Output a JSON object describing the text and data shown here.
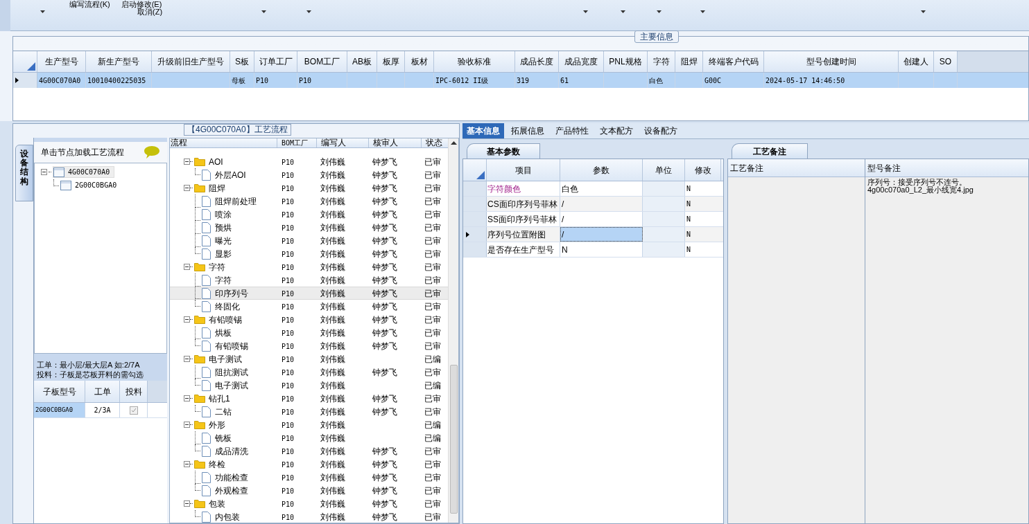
{
  "toolbar": {
    "buttons": [
      {
        "label": "编写流程(K)"
      },
      {
        "label": "启动修改(E)"
      },
      {
        "label": "取消(Z)"
      }
    ]
  },
  "main_info": {
    "title": "主要信息",
    "columns": [
      "生产型号",
      "新生产型号",
      "升级前旧生产型号",
      "S板",
      "订单工厂",
      "BOM工厂",
      "AB板",
      "板厚",
      "板材",
      "验收标准",
      "成品长度",
      "成品宽度",
      "PNL规格",
      "字符",
      "阻焊",
      "终端客户代码",
      "型号创建时间",
      "创建人",
      "SO"
    ],
    "rows": [
      {
        "selected": true,
        "cells": [
          "4G00C070A0",
          "10010400225035",
          null,
          "母板",
          "P10",
          "P10",
          null,
          null,
          null,
          "IPC-6012 II级",
          "319",
          "61",
          null,
          "白色",
          null,
          "G00C",
          "2024-05-17 14:46:50",
          null,
          null
        ]
      }
    ]
  },
  "structure_panel": {
    "tab": "设备结构",
    "hint": "单击节点加载工艺流程",
    "tree": [
      {
        "label": "4G00C070A0",
        "selected": true,
        "expanded": true,
        "children": [
          {
            "label": "2G00C0BGA0",
            "selected": false
          }
        ]
      }
    ],
    "notes": [
      "工单：最小层/最大层A 如:2/7A",
      "投料：子板是芯板开料的需勾选"
    ],
    "sub_table": {
      "columns": [
        "子板型号",
        "工单",
        "投料"
      ],
      "rows": [
        {
          "model": "2G00C0BGA0",
          "order": "2/3A",
          "feed": true
        }
      ]
    }
  },
  "process_flow": {
    "title": "【4G00C070A0】工艺流程",
    "columns": [
      "流程",
      "BOM工厂",
      "编写人",
      "核审人",
      "状态"
    ],
    "rows": [
      {
        "name": "AOI",
        "bom": "P10",
        "writer": "刘伟巍",
        "reviewer": "钟梦飞",
        "status": "已审",
        "expanded": true,
        "children": [
          {
            "name": "外层AOI",
            "bom": "P10",
            "writer": "刘伟巍",
            "reviewer": "钟梦飞",
            "status": "已审",
            "selected": false
          }
        ]
      },
      {
        "name": "阻焊",
        "bom": "P10",
        "writer": "刘伟巍",
        "reviewer": "钟梦飞",
        "status": "已审",
        "expanded": true,
        "children": [
          {
            "name": "阻焊前处理",
            "bom": "P10",
            "writer": "刘伟巍",
            "reviewer": "钟梦飞",
            "status": "已审",
            "selected": false
          },
          {
            "name": "喷涂",
            "bom": "P10",
            "writer": "刘伟巍",
            "reviewer": "钟梦飞",
            "status": "已审",
            "selected": false
          },
          {
            "name": "预烘",
            "bom": "P10",
            "writer": "刘伟巍",
            "reviewer": "钟梦飞",
            "status": "已审",
            "selected": false
          },
          {
            "name": "曝光",
            "bom": "P10",
            "writer": "刘伟巍",
            "reviewer": "钟梦飞",
            "status": "已审",
            "selected": false
          },
          {
            "name": "显影",
            "bom": "P10",
            "writer": "刘伟巍",
            "reviewer": "钟梦飞",
            "status": "已审",
            "selected": false
          }
        ]
      },
      {
        "name": "字符",
        "bom": "P10",
        "writer": "刘伟巍",
        "reviewer": "钟梦飞",
        "status": "已审",
        "expanded": true,
        "children": [
          {
            "name": "字符",
            "bom": "P10",
            "writer": "刘伟巍",
            "reviewer": "钟梦飞",
            "status": "已审",
            "selected": false
          },
          {
            "name": "印序列号",
            "bom": "P10",
            "writer": "刘伟巍",
            "reviewer": "钟梦飞",
            "status": "已审",
            "selected": true
          },
          {
            "name": "终固化",
            "bom": "P10",
            "writer": "刘伟巍",
            "reviewer": "钟梦飞",
            "status": "已审",
            "selected": false
          }
        ]
      },
      {
        "name": "有铅喷锡",
        "bom": "P10",
        "writer": "刘伟巍",
        "reviewer": "钟梦飞",
        "status": "已审",
        "expanded": true,
        "children": [
          {
            "name": "烘板",
            "bom": "P10",
            "writer": "刘伟巍",
            "reviewer": "钟梦飞",
            "status": "已审",
            "selected": false
          },
          {
            "name": "有铅喷锡",
            "bom": "P10",
            "writer": "刘伟巍",
            "reviewer": "钟梦飞",
            "status": "已审",
            "selected": false
          }
        ]
      },
      {
        "name": "电子测试",
        "bom": "P10",
        "writer": "刘伟巍",
        "status": "已编",
        "expanded": true,
        "children": [
          {
            "name": "阻抗测试",
            "bom": "P10",
            "writer": "刘伟巍",
            "reviewer": "钟梦飞",
            "status": "已审",
            "selected": false
          },
          {
            "name": "电子测试",
            "bom": "P10",
            "writer": "刘伟巍",
            "status": "已编",
            "selected": false
          }
        ]
      },
      {
        "name": "钻孔1",
        "bom": "P10",
        "writer": "刘伟巍",
        "reviewer": "钟梦飞",
        "status": "已审",
        "expanded": true,
        "children": [
          {
            "name": "二钻",
            "bom": "P10",
            "writer": "刘伟巍",
            "reviewer": "钟梦飞",
            "status": "已审",
            "selected": false
          }
        ]
      },
      {
        "name": "外形",
        "bom": "P10",
        "writer": "刘伟巍",
        "status": "已编",
        "expanded": true,
        "children": [
          {
            "name": "铣板",
            "bom": "P10",
            "writer": "刘伟巍",
            "status": "已编",
            "selected": false
          },
          {
            "name": "成品清洗",
            "bom": "P10",
            "writer": "刘伟巍",
            "reviewer": "钟梦飞",
            "status": "已审",
            "selected": false
          }
        ]
      },
      {
        "name": "终检",
        "bom": "P10",
        "writer": "刘伟巍",
        "reviewer": "钟梦飞",
        "status": "已审",
        "expanded": true,
        "children": [
          {
            "name": "功能检查",
            "bom": "P10",
            "writer": "刘伟巍",
            "reviewer": "钟梦飞",
            "status": "已审",
            "selected": false
          },
          {
            "name": "外观检查",
            "bom": "P10",
            "writer": "刘伟巍",
            "reviewer": "钟梦飞",
            "status": "已审",
            "selected": false
          }
        ]
      },
      {
        "name": "包装",
        "bom": "P10",
        "writer": "刘伟巍",
        "reviewer": "钟梦飞",
        "status": "已审",
        "expanded": true,
        "children": [
          {
            "name": "内包装",
            "bom": "P10",
            "writer": "刘伟巍",
            "reviewer": "钟梦飞",
            "status": "已审",
            "selected": false
          }
        ]
      }
    ]
  },
  "tabs": [
    {
      "label": "基本信息",
      "selected": true
    },
    {
      "label": "拓展信息",
      "selected": false
    },
    {
      "label": "产品特性",
      "selected": false
    },
    {
      "label": "文本配方",
      "selected": false
    },
    {
      "label": "设备配方",
      "selected": false
    }
  ],
  "basic_params": {
    "tab": "基本参数",
    "columns": [
      "项目",
      "参数",
      "单位",
      "修改"
    ],
    "rows": [
      {
        "item": "字符颜色",
        "param": "白色",
        "modified": "N",
        "emphasis": true,
        "selected": false
      },
      {
        "item": "CS面印序列号菲林",
        "param": "/",
        "modified": "N",
        "emphasis": false,
        "selected": false
      },
      {
        "item": "SS面印序列号菲林",
        "param": "/",
        "modified": "N",
        "emphasis": false,
        "selected": false
      },
      {
        "item": "序列号位置附图",
        "param": "/",
        "modified": "N",
        "emphasis": false,
        "selected": true
      },
      {
        "item": "是否存在生产型号",
        "param": "N",
        "modified": "N",
        "emphasis": false,
        "selected": false
      }
    ]
  },
  "remarks": {
    "tab": "工艺备注",
    "columns": [
      "工艺备注",
      "型号备注"
    ],
    "model_note": [
      "序列号：接受序列号不连号。",
      "4g00c070a0_L2_最小线宽4.jpg"
    ]
  }
}
